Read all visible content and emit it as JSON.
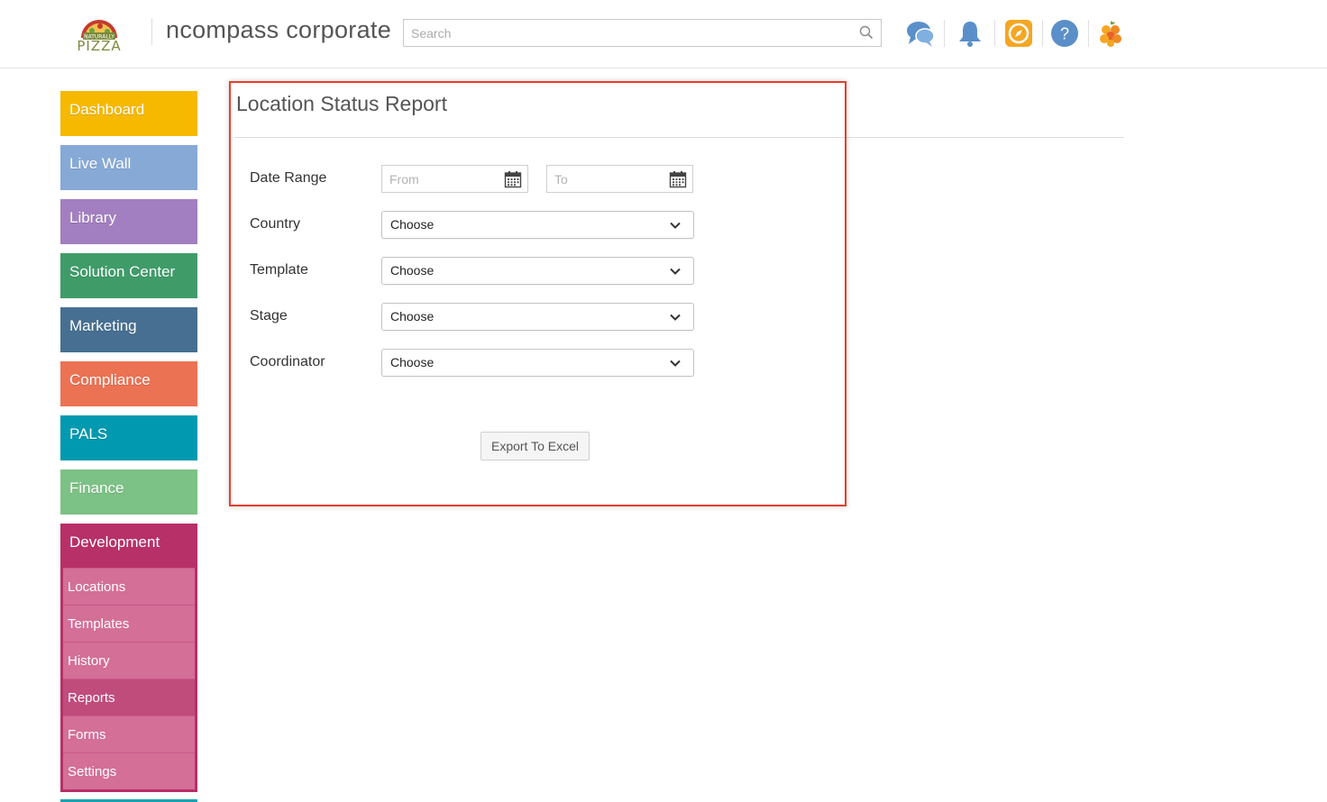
{
  "header": {
    "logo_text": "PIZZA",
    "logo_badge": "NATURALLY",
    "app_title": "ncompass corporate",
    "search_placeholder": "Search",
    "icons": [
      "chat-icon",
      "bell-icon",
      "compass-icon",
      "help-icon",
      "fruit-icon"
    ],
    "colors": {
      "chat": "#5b8fc9",
      "bell": "#5b8fc9",
      "compass": "#f5a623",
      "help": "#5b8fc9",
      "fruit": "#f08a24"
    }
  },
  "sidebar": {
    "items": [
      {
        "label": "Dashboard",
        "color": "#f6b900"
      },
      {
        "label": "Live Wall",
        "color": "#86a9d6"
      },
      {
        "label": "Library",
        "color": "#a27fc0"
      },
      {
        "label": "Solution Center",
        "color": "#3f9c69"
      },
      {
        "label": "Marketing",
        "color": "#466f91"
      },
      {
        "label": "Compliance",
        "color": "#ec7254"
      },
      {
        "label": "PALS",
        "color": "#0099b0"
      },
      {
        "label": "Finance",
        "color": "#7cc185"
      }
    ],
    "development": {
      "label": "Development",
      "color": "#b73068",
      "subitems": [
        {
          "label": "Locations"
        },
        {
          "label": "Templates"
        },
        {
          "label": "History"
        },
        {
          "label": "Reports",
          "active": true
        },
        {
          "label": "Forms"
        },
        {
          "label": "Settings"
        }
      ]
    }
  },
  "report": {
    "title": "Location Status Report",
    "date_range_label": "Date Range",
    "from_placeholder": "From",
    "to_placeholder": "To",
    "fields": [
      {
        "label": "Country",
        "value": "Choose"
      },
      {
        "label": "Template",
        "value": "Choose"
      },
      {
        "label": "Stage",
        "value": "Choose"
      },
      {
        "label": "Coordinator",
        "value": "Choose"
      }
    ],
    "export_label": "Export To Excel",
    "highlight_color": "#ec3b2b"
  }
}
